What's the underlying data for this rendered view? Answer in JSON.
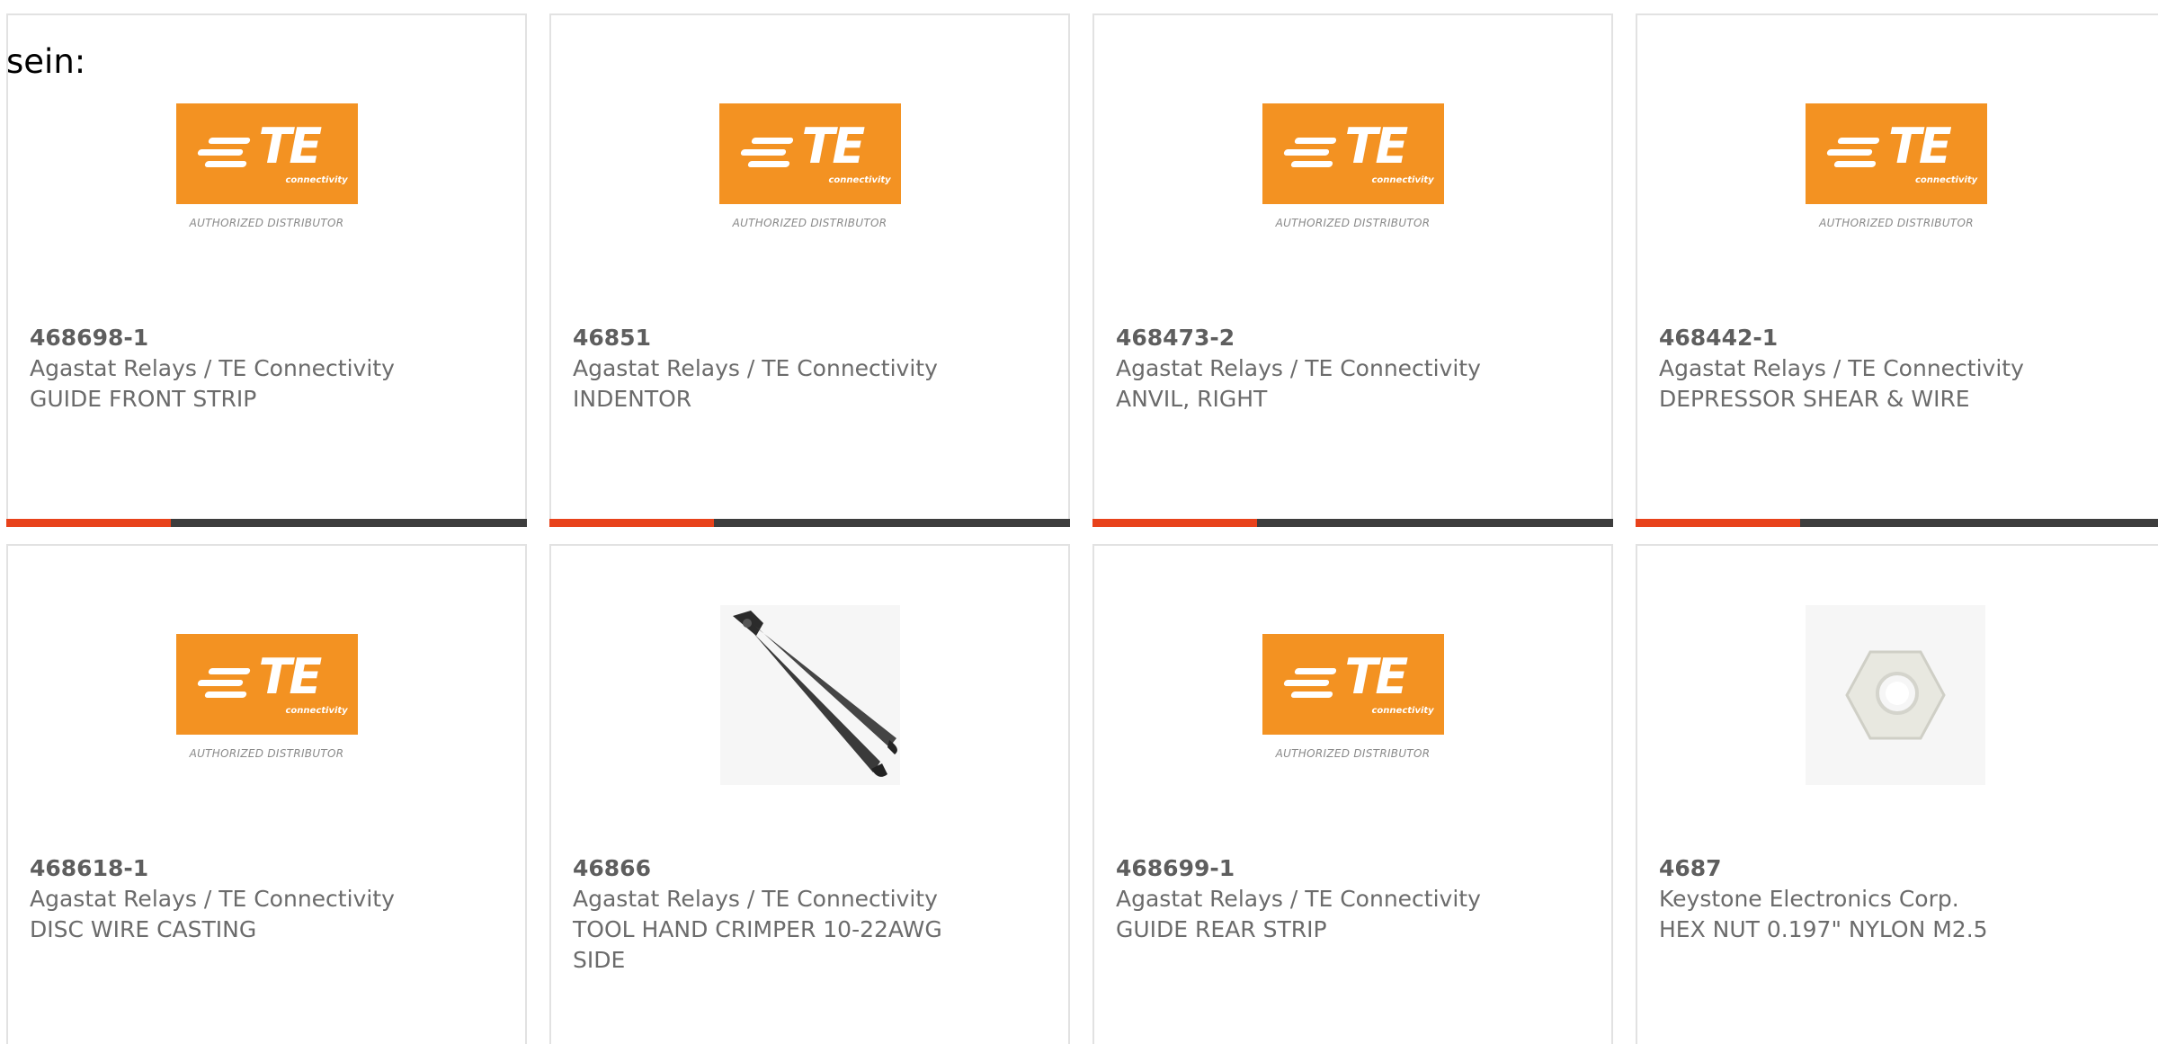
{
  "overlay_text": "sein:",
  "logo": {
    "te_letters": "TE",
    "te_sub": "connectivity",
    "caption": "AUTHORIZED DISTRIBUTOR",
    "color": "#f39222"
  },
  "accent_colors": {
    "accent": "#e8421b",
    "bar": "#3d3d3d"
  },
  "products": [
    {
      "part": "468698-1",
      "manufacturer": "Agastat Relays / TE Connectivity",
      "description": "GUIDE FRONT STRIP",
      "image": "te-logo"
    },
    {
      "part": "46851",
      "manufacturer": "Agastat Relays / TE Connectivity",
      "description": "INDENTOR",
      "image": "te-logo"
    },
    {
      "part": "468473-2",
      "manufacturer": "Agastat Relays / TE Connectivity",
      "description": "ANVIL, RIGHT",
      "image": "te-logo"
    },
    {
      "part": "468442-1",
      "manufacturer": "Agastat Relays / TE Connectivity",
      "description": "DEPRESSOR SHEAR & WIRE",
      "image": "te-logo"
    },
    {
      "part": "468618-1",
      "manufacturer": "Agastat Relays / TE Connectivity",
      "description": "DISC WIRE CASTING",
      "image": "te-logo"
    },
    {
      "part": "46866",
      "manufacturer": "Agastat Relays / TE Connectivity",
      "description": "TOOL HAND CRIMPER 10-22AWG SIDE",
      "image": "crimper-tool"
    },
    {
      "part": "468699-1",
      "manufacturer": "Agastat Relays / TE Connectivity",
      "description": "GUIDE REAR STRIP",
      "image": "te-logo"
    },
    {
      "part": "4687",
      "manufacturer": "Keystone Electronics Corp.",
      "description": "HEX NUT 0.197\" NYLON M2.5",
      "image": "hex-nut"
    }
  ]
}
